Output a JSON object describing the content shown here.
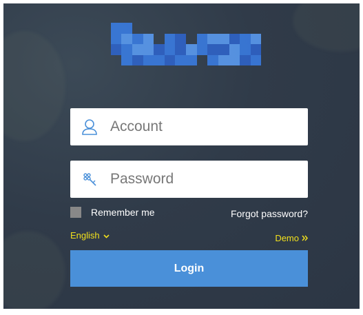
{
  "brand": {
    "logo_text": "",
    "logo_colors": [
      "#3a7be0",
      "#5a9af0",
      "#2f63c8",
      "#7fb4f5"
    ]
  },
  "form": {
    "account": {
      "icon": "user-icon",
      "placeholder": "Account",
      "value": ""
    },
    "password": {
      "icon": "key-icon",
      "placeholder": "Password",
      "value": ""
    },
    "remember_label": "Remember me",
    "remember_checked": false,
    "forgot_label": "Forgot password?",
    "language_label": "English",
    "language_icon": "chevron-down-icon",
    "demo_label": "Demo",
    "demo_icon": "double-chevron-right-icon",
    "login_label": "Login"
  },
  "colors": {
    "background": "#303b49",
    "accent_yellow": "#f2e01c",
    "login_button": "#4a90d9",
    "checkbox": "#888888"
  }
}
